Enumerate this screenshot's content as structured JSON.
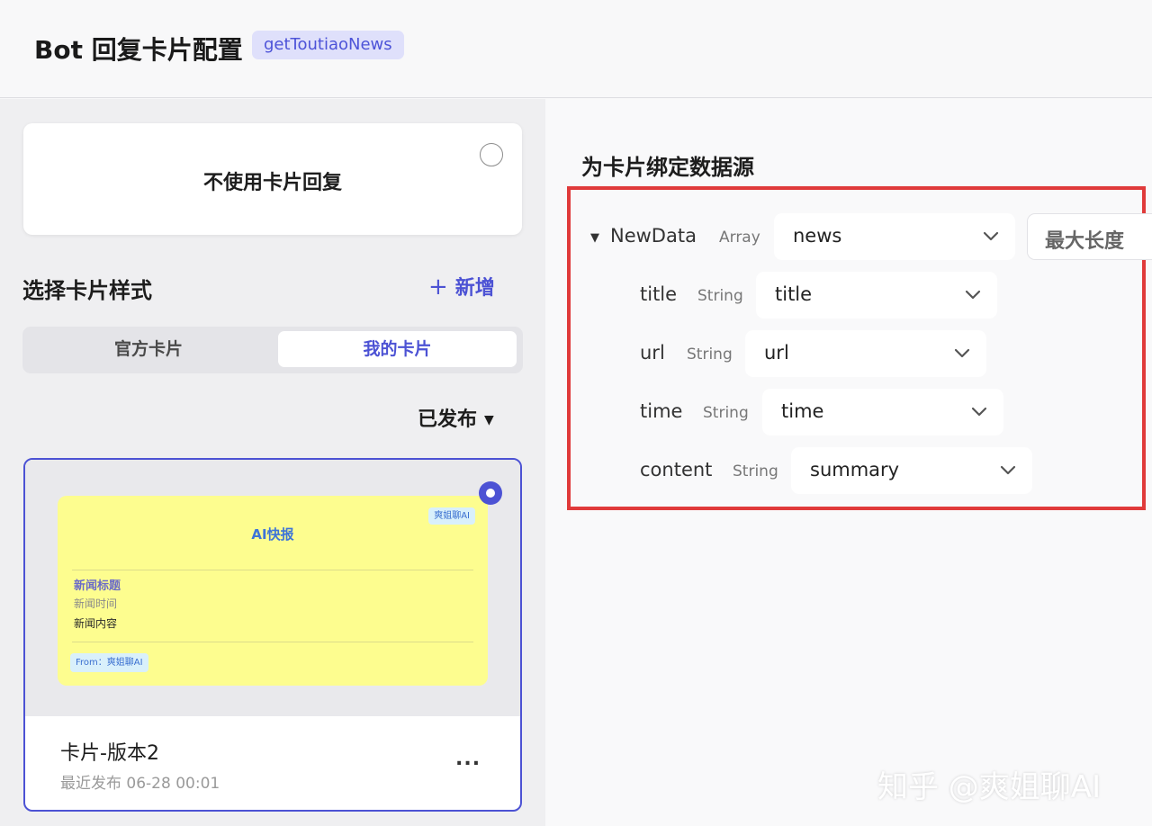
{
  "header": {
    "title": "Bot 回复卡片配置",
    "tag": "getToutiaoNews"
  },
  "left": {
    "no_card_label": "不使用卡片回复",
    "section_title": "选择卡片样式",
    "add_label": "新增",
    "tabs": [
      {
        "label": "官方卡片"
      },
      {
        "label": "我的卡片"
      }
    ],
    "filter_label": "已发布",
    "card": {
      "preview": {
        "badge": "爽姐聊AI",
        "title": "AI快报",
        "line1": "新闻标题",
        "line2": "新闻时间",
        "line3": "新闻内容",
        "from": "From：爽姐聊AI"
      },
      "name": "卡片-版本2",
      "date": "最近发布 06-28 00:01",
      "more": "..."
    }
  },
  "right": {
    "title": "为卡片绑定数据源",
    "root": {
      "name": "NewData",
      "type": "Array",
      "value": "news",
      "max_length_label": "最大长度"
    },
    "fields": [
      {
        "name": "title",
        "type": "String",
        "value": "title"
      },
      {
        "name": "url",
        "type": "String",
        "value": "url"
      },
      {
        "name": "time",
        "type": "String",
        "value": "time"
      },
      {
        "name": "content",
        "type": "String",
        "value": "summary"
      }
    ]
  },
  "watermark": "知乎 @爽姐聊AI",
  "colors": {
    "accent": "#4c52d4",
    "highlight_box": "#e03a3a",
    "card_bg": "#fdfd8f"
  }
}
